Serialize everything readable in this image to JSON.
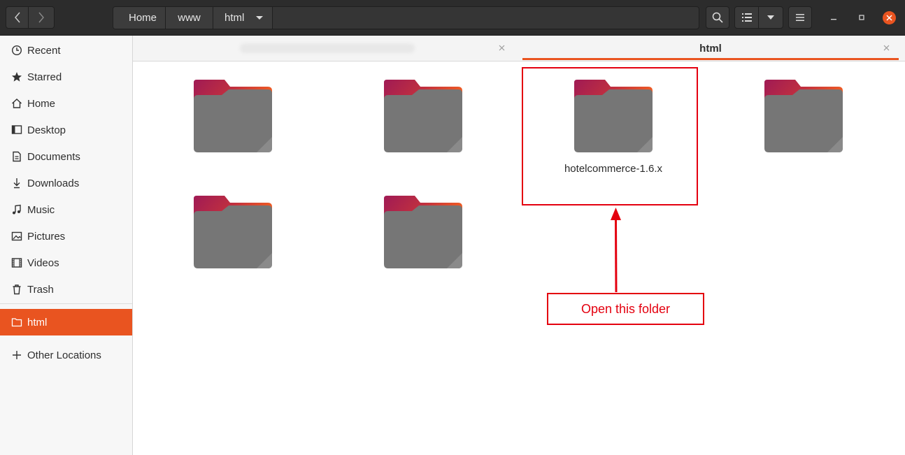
{
  "header": {
    "breadcrumbs": [
      "Home",
      "www",
      "html"
    ],
    "icons": {
      "back": "chevron-left-icon",
      "forward": "chevron-right-icon",
      "search": "search-icon",
      "list_view": "list-view-icon",
      "view_options": "chevron-down-icon",
      "menu": "hamburger-menu-icon",
      "minimize": "minimize-icon",
      "maximize": "maximize-icon",
      "close": "close-icon"
    }
  },
  "sidebar": {
    "items": [
      {
        "label": "Recent",
        "icon": "clock-icon"
      },
      {
        "label": "Starred",
        "icon": "star-icon"
      },
      {
        "label": "Home",
        "icon": "home-icon"
      },
      {
        "label": "Desktop",
        "icon": "desktop-icon"
      },
      {
        "label": "Documents",
        "icon": "document-icon"
      },
      {
        "label": "Downloads",
        "icon": "download-icon"
      },
      {
        "label": "Music",
        "icon": "music-icon"
      },
      {
        "label": "Pictures",
        "icon": "picture-icon"
      },
      {
        "label": "Videos",
        "icon": "video-icon"
      },
      {
        "label": "Trash",
        "icon": "trash-icon"
      },
      {
        "label": "html",
        "icon": "folder-icon",
        "active": true
      },
      {
        "label": "Other Locations",
        "icon": "plus-icon"
      }
    ]
  },
  "tabs": [
    {
      "label": "",
      "blurred": true
    },
    {
      "label": "html",
      "active": true
    }
  ],
  "files": [
    {
      "name": ""
    },
    {
      "name": ""
    },
    {
      "name": "hotelcommerce-1.6.x"
    },
    {
      "name": ""
    },
    {
      "name": ""
    },
    {
      "name": ""
    }
  ],
  "annotation": {
    "note": "Open this folder"
  },
  "colors": {
    "accent": "#e95420",
    "annotation": "#e4000f",
    "headerbar": "#2c2c2c"
  }
}
